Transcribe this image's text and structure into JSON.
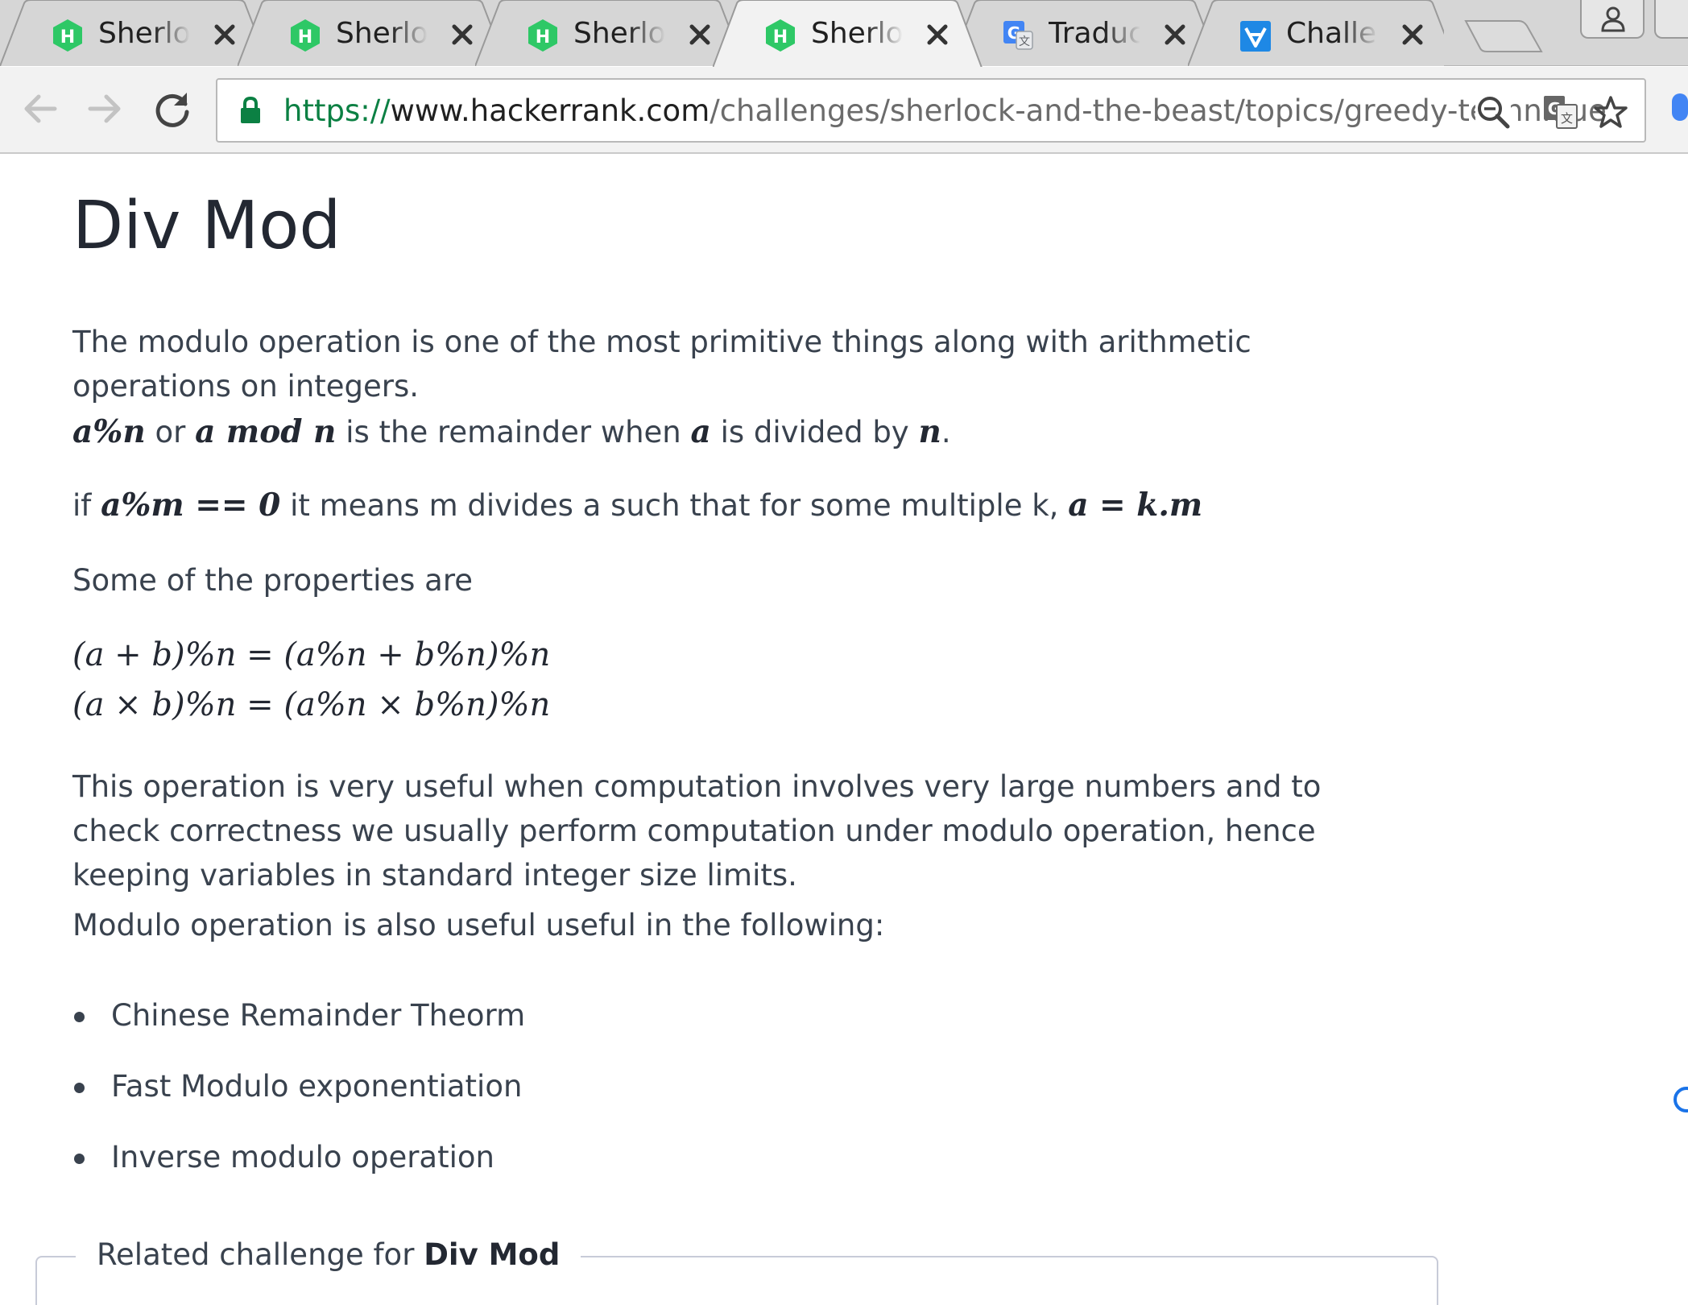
{
  "browser": {
    "tabs": [
      {
        "title": "Sherlock and The Beast | HackerRank",
        "favicon": "hackerrank-icon",
        "active": false
      },
      {
        "title": "Sherlock and The Beast | HackerRank",
        "favicon": "hackerrank-icon",
        "active": false
      },
      {
        "title": "Sherlock and The Beast | HackerRank",
        "favicon": "hackerrank-icon",
        "active": false
      },
      {
        "title": "Sherlock and The Beast | HackerRank",
        "favicon": "hackerrank-icon",
        "active": true
      },
      {
        "title": "Traductor de Google",
        "favicon": "google-translate-icon",
        "active": false
      },
      {
        "title": "Challenges",
        "favicon": "challenges-icon",
        "active": false
      }
    ],
    "url": {
      "scheme": "https://",
      "host": "www.hackerrank.com",
      "path": "/challenges/sherlock-and-the-beast/topics/greedy-technique"
    },
    "colors": {
      "hackerrank_green": "#2ec866",
      "secure_green": "#0b8043",
      "accent_blue": "#1a73e8"
    }
  },
  "article": {
    "title": "Div Mod",
    "intro": "The modulo operation is one of the most primitive things along with arithmetic operations on integers.",
    "def": {
      "expr1": "a%n",
      "or": "or",
      "expr2": "a mod n",
      "text1": "is the remainder when",
      "var_a": "a",
      "text2": "is divided by",
      "var_n": "n",
      "end": "."
    },
    "divides": {
      "if": "if",
      "expr": "a%m == 0",
      "text": "it means m divides a such that for some multiple k,",
      "expr2": "a = k.m"
    },
    "properties_label": "Some of the properties are",
    "formulas": [
      "(a + b)%n = (a%n + b%n)%n",
      "(a × b)%n = (a%n × b%n)%n"
    ],
    "usefulness": "This operation is very useful when computation involves very large numbers and to check correctness we usually perform computation under modulo operation, hence keeping variables in standard integer size limits.",
    "following_label": "Modulo operation is also useful useful in the following:",
    "list": [
      "Chinese Remainder Theorm",
      "Fast Modulo exponentiation",
      "Inverse modulo operation"
    ],
    "related": {
      "prefix": "Related challenge for",
      "name": "Div Mod"
    }
  }
}
